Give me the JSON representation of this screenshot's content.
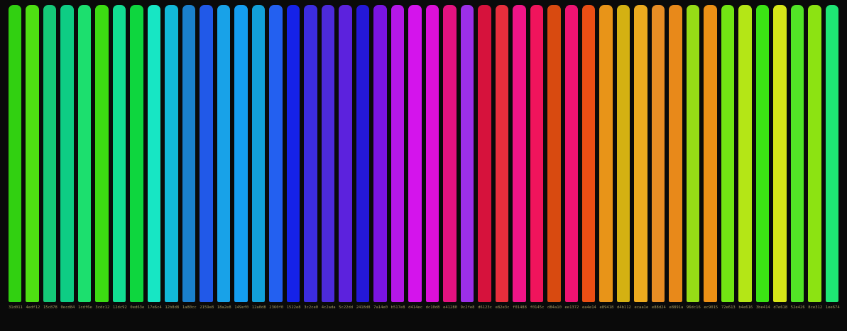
{
  "background": "#0a0a0a",
  "label_color": "#a59a62",
  "chart_data": {
    "type": "bar",
    "title": "",
    "xlabel": "",
    "ylabel": "",
    "categories": [
      "31d011",
      "4edf12",
      "15c878",
      "0ecd84",
      "1cdf6e",
      "3cdc12",
      "12dc92",
      "0ed63e",
      "17e6c4",
      "12b8d8",
      "1a80cc",
      "2159e8",
      "18a2e8",
      "149ef0",
      "12a0d8",
      "2360f0",
      "1522e8",
      "3c2ce0",
      "4c2ada",
      "5c22dd",
      "2418d8",
      "7a14e0",
      "b517e8",
      "d414ec",
      "dc10d8",
      "e41280",
      "9c2fe8",
      "d6123c",
      "e82e3c",
      "f01488",
      "f0145c",
      "d84a10",
      "ee1372",
      "ea4e14",
      "e89418",
      "d4b112",
      "ecaa1e",
      "e88d24",
      "e8891a",
      "96dc16",
      "ec9015",
      "72e613",
      "b4e616",
      "3be414",
      "d7e618",
      "52e426",
      "8ce312",
      "1ee674"
    ],
    "values": [
      1,
      1,
      1,
      1,
      1,
      1,
      1,
      1,
      1,
      1,
      1,
      1,
      1,
      1,
      1,
      1,
      1,
      1,
      1,
      1,
      1,
      1,
      1,
      1,
      1,
      1,
      1,
      1,
      1,
      1,
      1,
      1,
      1,
      1,
      1,
      1,
      1,
      1,
      1,
      1,
      1,
      1,
      1,
      1,
      1,
      1,
      1,
      1
    ],
    "colors": [
      "#31d011",
      "#4edf12",
      "#15c878",
      "#0ecd84",
      "#1cdf6e",
      "#3cdc12",
      "#12dc92",
      "#0ed63e",
      "#17e6c4",
      "#12b8d8",
      "#1a80cc",
      "#2159e8",
      "#18a2e8",
      "#149ef0",
      "#12a0d8",
      "#2360f0",
      "#1522e8",
      "#3c2ce0",
      "#4c2ada",
      "#5c22dd",
      "#2418d8",
      "#7a14e0",
      "#b517e8",
      "#d414ec",
      "#dc10d8",
      "#e41280",
      "#9c2fe8",
      "#d6123c",
      "#e82e3c",
      "#f01488",
      "#f0145c",
      "#d84a10",
      "#ee1372",
      "#ea4e14",
      "#e89418",
      "#d4b112",
      "#ecaa1e",
      "#e88d24",
      "#e8891a",
      "#96dc16",
      "#ec9015",
      "#72e613",
      "#b4e616",
      "#3be414",
      "#d7e618",
      "#52e426",
      "#8ce312",
      "#1ee674"
    ],
    "layout": {
      "orientation": "vertical",
      "uniform_height": true,
      "grid": false,
      "legend": false,
      "background": "#0a0a0a"
    }
  }
}
